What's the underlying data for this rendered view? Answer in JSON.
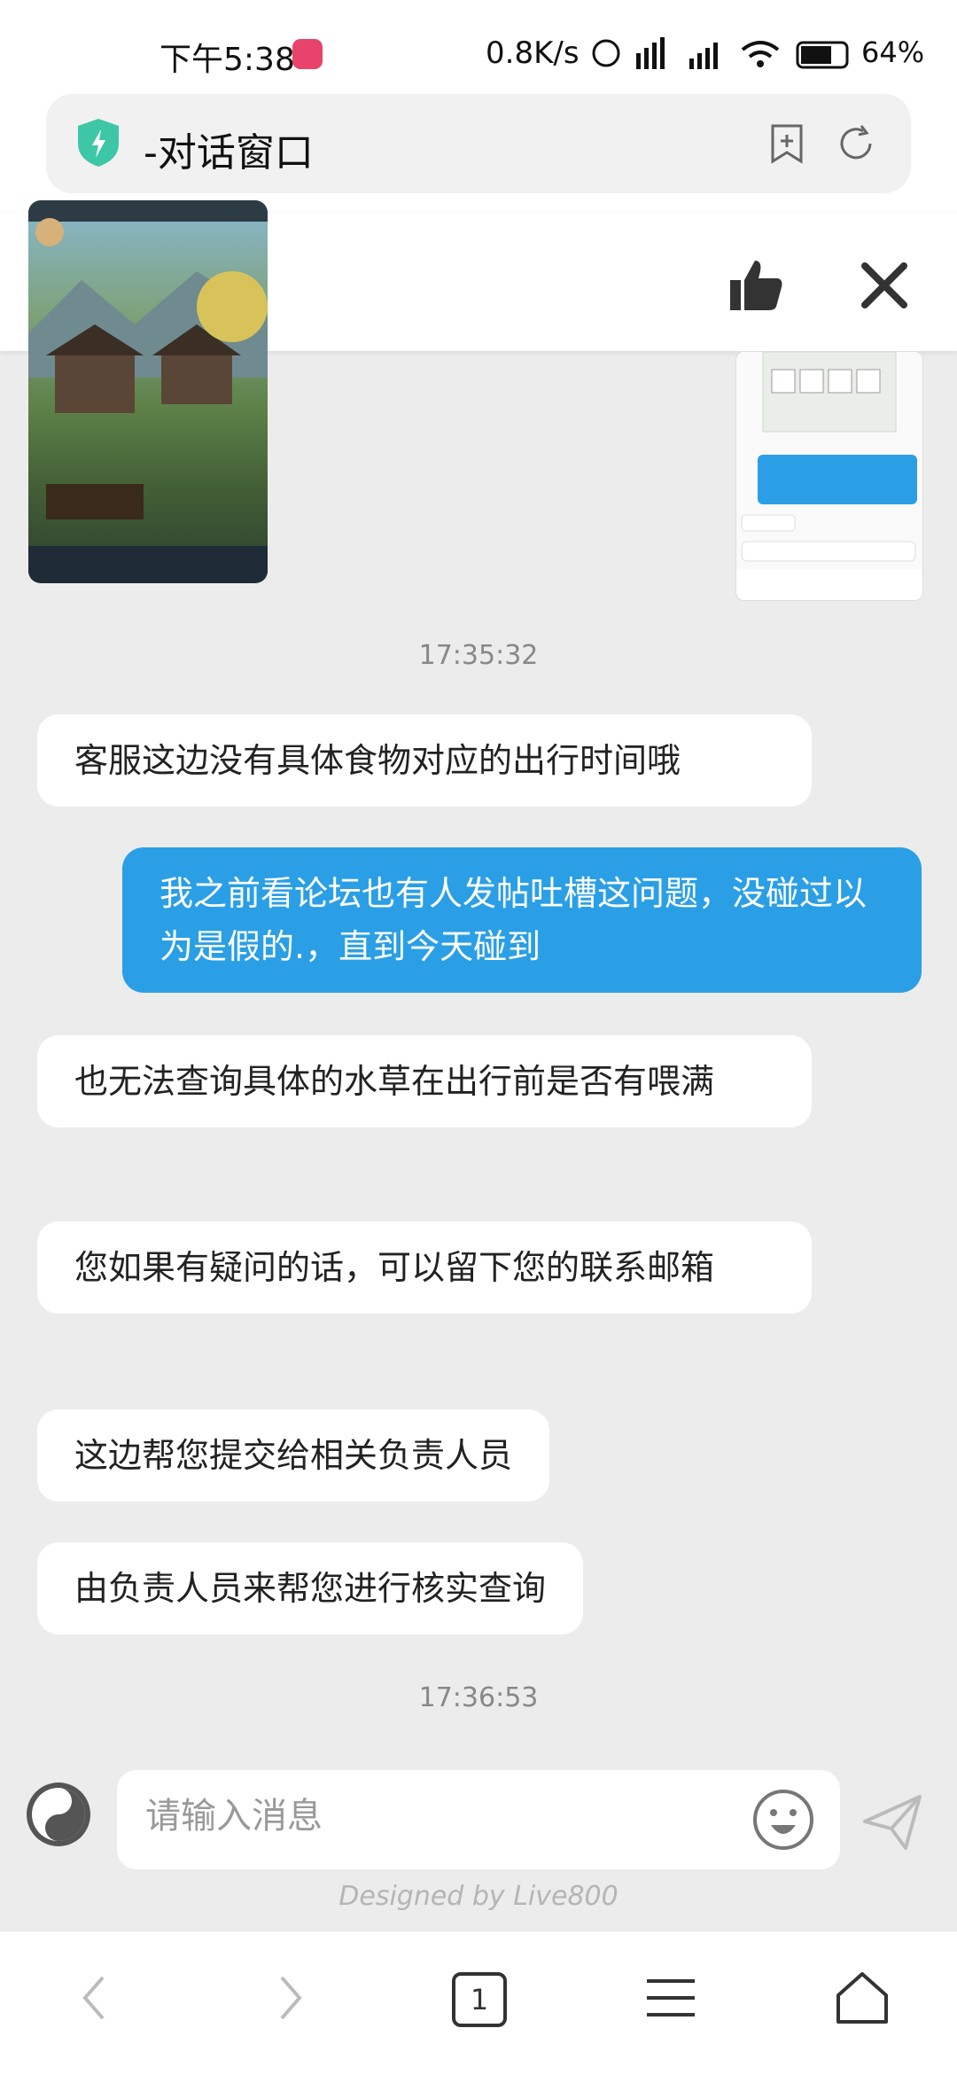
{
  "status_bar": {
    "time": "下午5:38",
    "net_speed": "0.8K/s",
    "battery": "64%"
  },
  "browser": {
    "title": "-对话窗口"
  },
  "chat": [
    {
      "type": "timestamp",
      "text": "17:35:32"
    },
    {
      "type": "agent",
      "text": "客服这边没有具体食物对应的出行时间哦"
    },
    {
      "type": "user",
      "text": "我之前看论坛也有人发帖吐槽这问题，没碰过以为是假的.，直到今天碰到"
    },
    {
      "type": "agent",
      "text": "也无法查询具体的水草在出行前是否有喂满"
    },
    {
      "type": "agent",
      "text": "您如果有疑问的话，可以留下您的联系邮箱"
    },
    {
      "type": "agent",
      "text": "这边帮您提交给相关负责人员"
    },
    {
      "type": "agent",
      "text": "由负责人员来帮您进行核实查询"
    },
    {
      "type": "timestamp",
      "text": "17:36:53"
    }
  ],
  "composer": {
    "placeholder": "请输入消息",
    "designed_by": "Designed by Live800"
  },
  "nav": {
    "tab_count": "1"
  },
  "colors": {
    "user_bubble": "#2a9fe6",
    "accent": "#2a9fe6"
  }
}
